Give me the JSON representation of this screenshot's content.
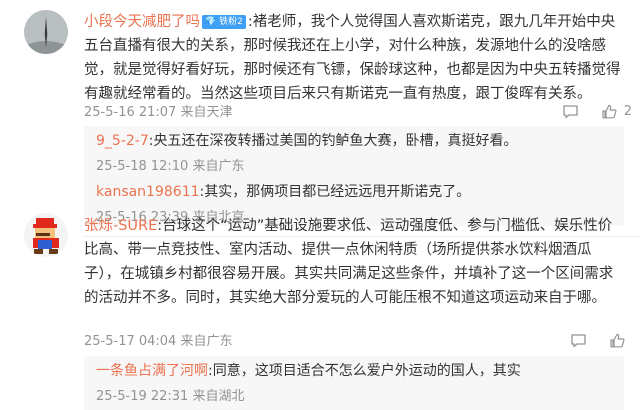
{
  "comments": [
    {
      "username": "小段今天减肥了吗",
      "badge": "铁粉2",
      "text": "褚老师，我个人觉得国人喜欢斯诺克，跟九几年开始中央五台直播有很大的关系，那时候我还在上小学，对什么种族，发源地什么的没啥感觉，就是觉得好看好玩，那时候还有飞镖，保龄球这种，也都是因为中央五转播觉得有趣就经常看的。当然这些项目后来只有斯诺克一直有热度，跟丁俊晖有关系。",
      "time": "25-5-16 21:07",
      "location": "来自天津",
      "likes": "2",
      "replies": [
        {
          "username": "9_5-2-7",
          "text": "央五还在深夜转播过美国的钓鲈鱼大赛，卧槽，真挺好看。",
          "time": "25-5-18 12:10",
          "location": "来自广东"
        },
        {
          "username": "kansan198611",
          "text": "其实，那俩项目都已经远远甩开斯诺克了。",
          "time": "25-5-16 23:39",
          "location": "来自北京"
        }
      ]
    },
    {
      "username": "张烁-SURE",
      "text": "台球这个“运动”基础设施要求低、运动强度低、参与门槛低、娱乐性价比高、带一点竞技性、室内活动、提供一点休闲特质（场所提供茶水饮料烟酒瓜子），在城镇乡村都很容易开展。其实共同满足这些条件，并填补了这一个区间需求的活动并不多。同时，其实绝大部分爱玩的人可能压根不知道这项运动来自于哪。",
      "time": "25-5-17 04:04",
      "location": "来自广东",
      "likes": "",
      "replies": [
        {
          "username": "一条鱼占满了河啊",
          "text": "同意，这项目适合不怎么爱户外运动的国人，其实",
          "time": "25-5-19 22:31",
          "location": "来自湖北"
        }
      ]
    }
  ],
  "icons": [
    "comment-bubble-icon",
    "thumbs-up-icon"
  ],
  "colors": {
    "username": "#eb7350",
    "meta": "#939393",
    "badge": "#3da0f5",
    "reply_bg": "#f7f7f7"
  }
}
